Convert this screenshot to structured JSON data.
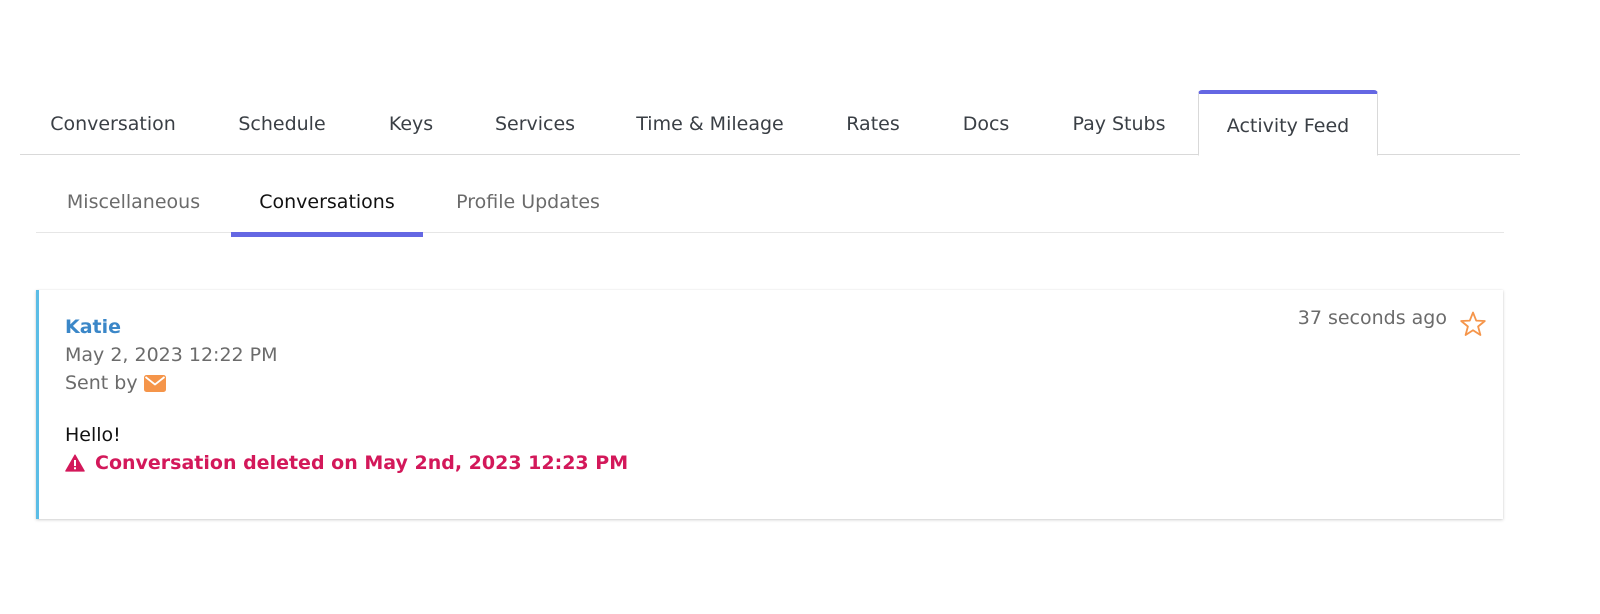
{
  "main_tabs": [
    {
      "label": "Conversation",
      "active": false
    },
    {
      "label": "Schedule",
      "active": false
    },
    {
      "label": "Keys",
      "active": false
    },
    {
      "label": "Services",
      "active": false
    },
    {
      "label": "Time & Mileage",
      "active": false
    },
    {
      "label": "Rates",
      "active": false
    },
    {
      "label": "Docs",
      "active": false
    },
    {
      "label": "Pay Stubs",
      "active": false
    },
    {
      "label": "Activity Feed",
      "active": true
    }
  ],
  "sub_tabs": [
    {
      "label": "Miscellaneous",
      "active": false
    },
    {
      "label": "Conversations",
      "active": true
    },
    {
      "label": "Profile Updates",
      "active": false
    }
  ],
  "feed": {
    "items": [
      {
        "author": "Katie",
        "date": "May 2, 2023 12:22 PM",
        "sent_by_label": "Sent by",
        "sent_by_icon": "envelope-icon",
        "message": "Hello!",
        "status_icon": "warning-icon",
        "status": "Conversation deleted on May 2nd, 2023 12:23 PM",
        "time_ago": "37 seconds ago",
        "starred": false
      }
    ]
  },
  "colors": {
    "accent": "#6467e3",
    "author_link": "#3b87c8",
    "card_border": "#5bbde6",
    "deleted": "#d3185a",
    "icon_orange": "#f5954a"
  }
}
